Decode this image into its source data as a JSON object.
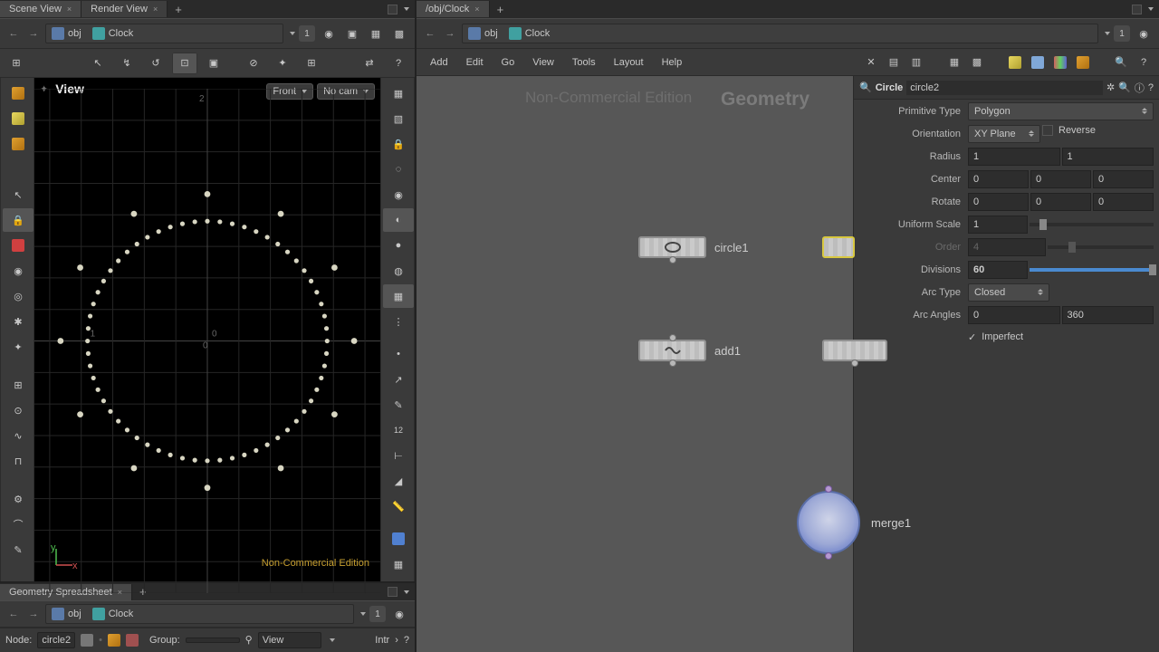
{
  "left": {
    "tabs": [
      "Scene View",
      "Render View"
    ],
    "path": {
      "context": "obj",
      "object": "Clock"
    },
    "pin": "1",
    "view": {
      "title": "View",
      "menu_front": "Front",
      "menu_cam": "No cam",
      "watermark": "Non-Commercial Edition",
      "axis_x": "x",
      "axis_y": "y",
      "labels": {
        "zero": "0",
        "zero2": "0",
        "one": "1",
        "neg": "2"
      }
    },
    "spreadsheet": {
      "tab": "Geometry Spreadsheet",
      "node_lbl": "Node:",
      "node_val": "circle2",
      "group_lbl": "Group:",
      "view_lbl": "View",
      "intr": "Intr"
    }
  },
  "right": {
    "tab": "/obj/Clock",
    "pin": "1",
    "menu": [
      "Add",
      "Edit",
      "Go",
      "View",
      "Tools",
      "Layout",
      "Help"
    ],
    "graph": {
      "watermark": "Non-Commercial Edition",
      "type_label": "Geometry",
      "nodes": {
        "circle1": "circle1",
        "add1": "add1",
        "merge1": "merge1"
      }
    },
    "params": {
      "type": "Circle",
      "name": "circle2",
      "rows": {
        "prim_type": {
          "label": "Primitive Type",
          "value": "Polygon"
        },
        "orientation": {
          "label": "Orientation",
          "value": "XY Plane",
          "reverse": "Reverse"
        },
        "radius": {
          "label": "Radius",
          "x": "1",
          "y": "1"
        },
        "center": {
          "label": "Center",
          "x": "0",
          "y": "0",
          "z": "0"
        },
        "rotate": {
          "label": "Rotate",
          "x": "0",
          "y": "0",
          "z": "0"
        },
        "uscale": {
          "label": "Uniform Scale",
          "value": "1"
        },
        "order": {
          "label": "Order",
          "value": "4"
        },
        "divisions": {
          "label": "Divisions",
          "value": "60"
        },
        "arc_type": {
          "label": "Arc Type",
          "value": "Closed"
        },
        "arc_angles": {
          "label": "Arc Angles",
          "a": "0",
          "b": "360"
        },
        "imperfect": {
          "label": "Imperfect"
        }
      }
    }
  }
}
